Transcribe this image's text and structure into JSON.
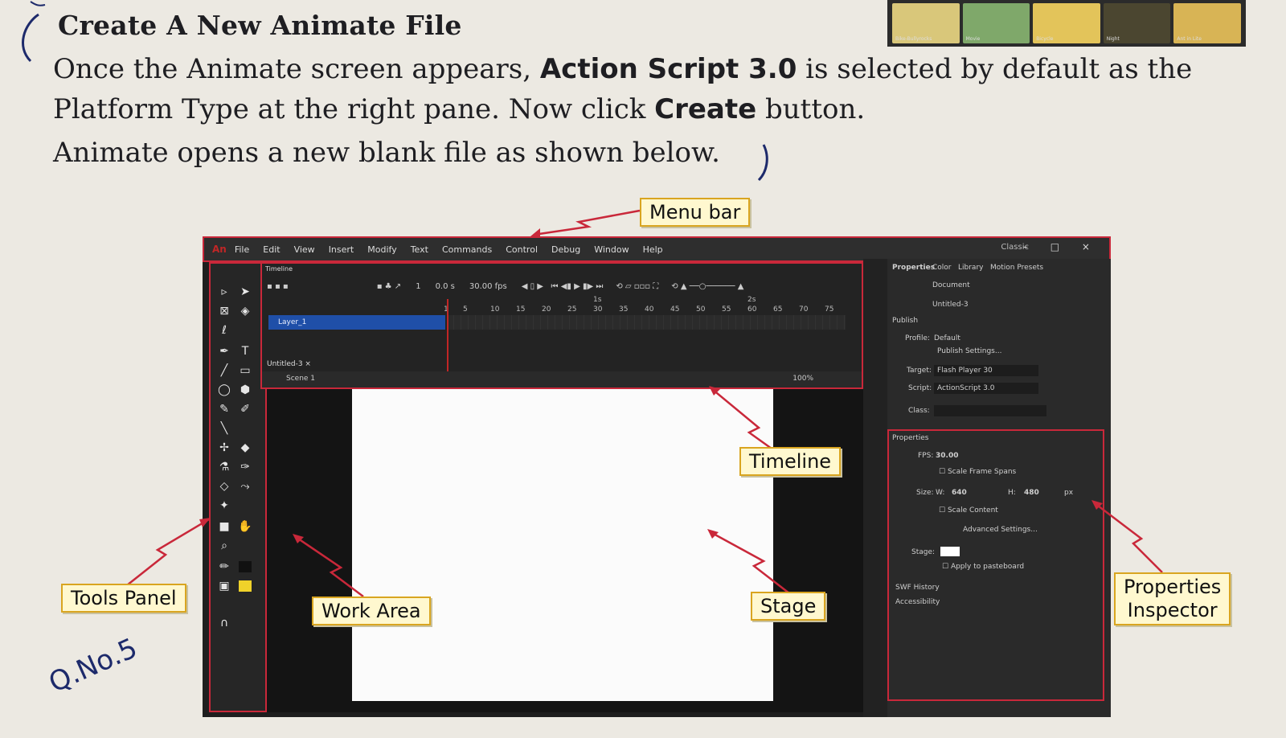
{
  "heading": "Create A New Animate File",
  "paragraph": {
    "line1_a": "Once the Animate screen appears, ",
    "line1_bold": "Action Script 3.0",
    "line1_b": " is selected by default as the",
    "line2_a": "Platform Type at the right pane. Now click ",
    "line2_bold": "Create",
    "line2_b": " button.",
    "line3": "Animate opens a new blank file as shown below."
  },
  "handwriting": {
    "note": "Q.No.5"
  },
  "thumbnails": [
    "Bike-Bullyrocks",
    "Movie",
    "Bicycle",
    "Night",
    "Ant in Lite"
  ],
  "app": {
    "logo": "An",
    "menu": [
      "File",
      "Edit",
      "View",
      "Insert",
      "Modify",
      "Text",
      "Commands",
      "Control",
      "Debug",
      "Window",
      "Help"
    ],
    "workspace": "Classic",
    "window_controls": "– □ ×",
    "timeline": {
      "title": "Timeline",
      "time": "0.0 s",
      "fps": "30.00 fps",
      "frame": "1",
      "ruler": [
        "1",
        "5",
        "10",
        "15",
        "20",
        "25",
        "30",
        "35",
        "40",
        "45",
        "50",
        "55",
        "60",
        "65",
        "70",
        "75"
      ],
      "sec1": "1s",
      "sec2": "2s",
      "layer": "Layer_1",
      "doc_tab": "Untitled-3 ×",
      "scene": "Scene 1",
      "zoom": "100%"
    },
    "properties": {
      "tabs": [
        "Properties",
        "Color",
        "Library",
        "Motion Presets"
      ],
      "document": "Document",
      "doc_name": "Untitled-3",
      "publish": "Publish",
      "profile_label": "Profile:",
      "profile": "Default",
      "publish_settings": "Publish Settings...",
      "target_label": "Target:",
      "target": "Flash Player 30",
      "script_label": "Script:",
      "script": "ActionScript 3.0",
      "class_label": "Class:",
      "section": "Properties",
      "fps_label": "FPS:",
      "fps": "30.00",
      "scale_frame": "Scale Frame Spans",
      "size_label": "Size:",
      "w_label": "W:",
      "w": "640",
      "h_label": "H:",
      "h": "480",
      "unit": "px",
      "scale_content": "Scale Content",
      "advanced": "Advanced Settings...",
      "stage_label": "Stage:",
      "apply": "Apply to pasteboard",
      "swf": "SWF History",
      "access": "Accessibility"
    }
  },
  "callouts": {
    "menu_bar": "Menu bar",
    "timeline": "Timeline",
    "tools_panel": "Tools Panel",
    "work_area": "Work Area",
    "stage": "Stage",
    "properties_1": "Properties",
    "properties_2": "Inspector"
  }
}
